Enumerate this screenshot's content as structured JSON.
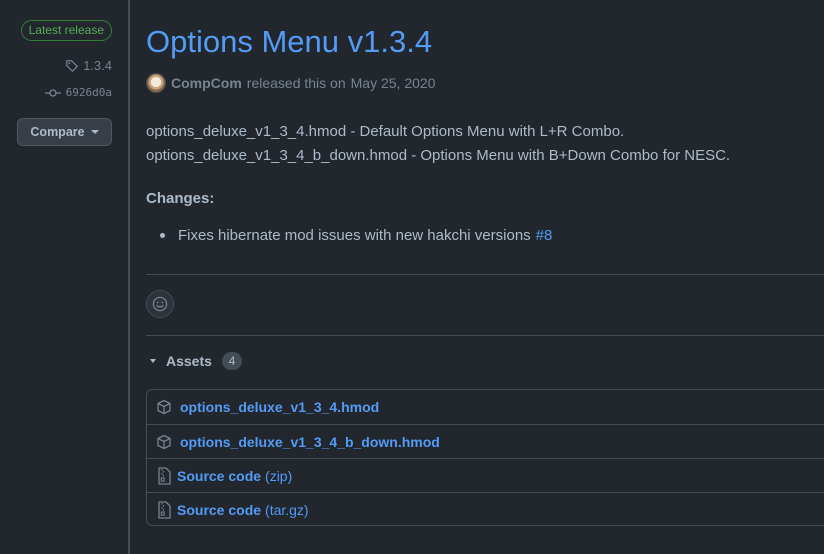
{
  "sidebar": {
    "badge": "Latest release",
    "tag": "1.3.4",
    "commit": "6926d0a",
    "compare_label": "Compare"
  },
  "release": {
    "title": "Options Menu v1.3.4",
    "author": "CompCom",
    "released_text": "released this on",
    "date": "May 25, 2020"
  },
  "body": {
    "lines": [
      "options_deluxe_v1_3_4.hmod - Default Options Menu with L+R Combo.",
      "options_deluxe_v1_3_4_b_down.hmod - Options Menu with B+Down Combo for NESC."
    ],
    "changes_heading": "Changes:",
    "changes": [
      {
        "text": "Fixes hibernate mod issues with new hakchi versions",
        "link": "#8"
      }
    ]
  },
  "assets": {
    "label": "Assets",
    "count": "4",
    "items": [
      {
        "name": "options_deluxe_v1_3_4.hmod",
        "icon": "package-icon"
      },
      {
        "name": "options_deluxe_v1_3_4_b_down.hmod",
        "icon": "package-icon"
      },
      {
        "name": "Source code",
        "ext": "(zip)",
        "icon": "file-zip-icon"
      },
      {
        "name": "Source code",
        "ext": "(tar.gz)",
        "icon": "file-zip-icon"
      }
    ]
  },
  "colors": {
    "background": "#22272e",
    "link": "#539bf5",
    "latest_badge": "#57ab5a",
    "text": "#adbac7",
    "muted": "#768390",
    "border": "#444c56"
  }
}
